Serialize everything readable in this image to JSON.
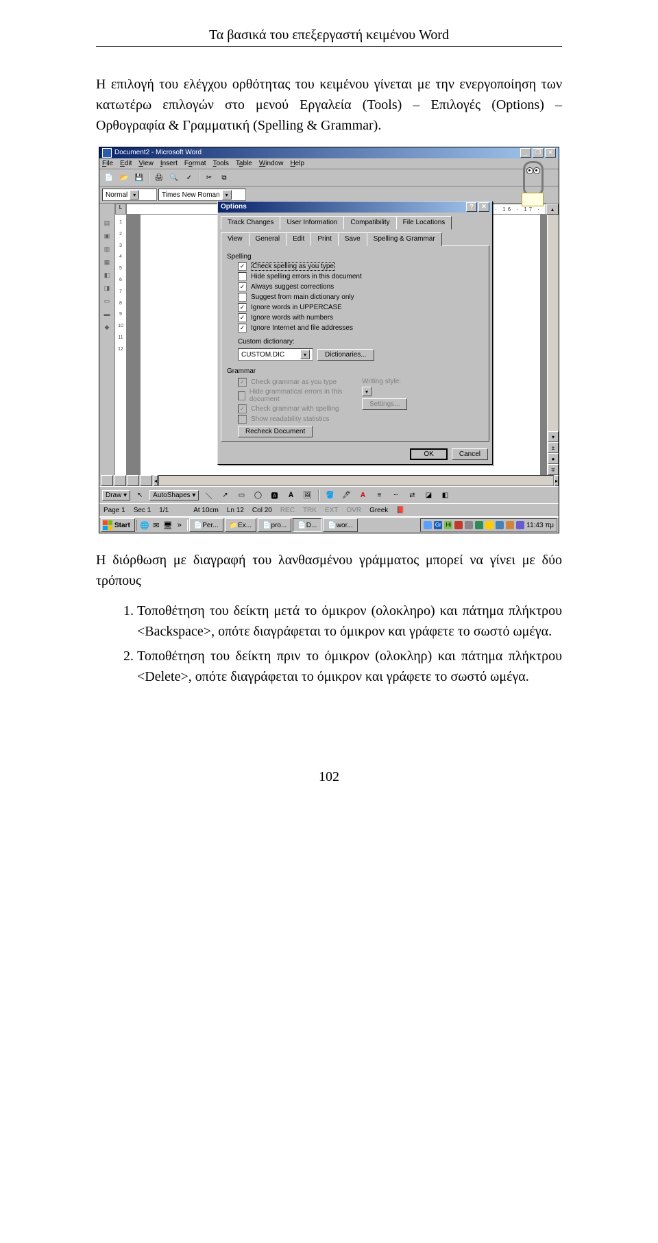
{
  "header": "Τα βασικά του επεξεργαστή κειμένου Word",
  "intro": "Η επιλογή του ελέγχου ορθότητας του κειμένου γίνεται με την ενεργοποίηση των κατωτέρω επιλογών στο μενού Εργαλεία (Tools) – Επιλογές (Options) – Ορθογραφία & Γραμματική (Spelling & Grammar).",
  "after": "Η διόρθωση με διαγραφή του λανθασμένου γράμματος μπορεί να γίνει με δύο τρόπους",
  "li1": "Τοποθέτηση του δείκτη μετά το όμικρον (ολοκληρο) και πάτημα πλήκτρου <Backspace>, οπότε διαγράφεται το όμικρον και γράφετε το σωστό ωμέγα.",
  "li2": "Τοποθέτηση του δείκτη πριν το όμικρον (ολοκληρ) και πάτημα πλήκτρου <Delete>, οπότε διαγράφεται το όμικρον και γράφετε το σωστό ωμέγα.",
  "page_number": "102",
  "word": {
    "title": "Document2 - Microsoft Word",
    "menus": {
      "file": "File",
      "edit": "Edit",
      "view": "View",
      "insert": "Insert",
      "format": "Format",
      "tools": "Tools",
      "table": "Table",
      "window": "Window",
      "help": "Help"
    },
    "style": "Normal",
    "font": "Times New Roman",
    "ruler_right": "15 · 16 · 17 ·",
    "draw": {
      "draw": "Draw",
      "autoshapes": "AutoShapes"
    },
    "status": {
      "page": "Page 1",
      "sec": "Sec 1",
      "pages": "1/1",
      "at": "At 10cm",
      "ln": "Ln 12",
      "col": "Col 20",
      "rec": "REC",
      "trk": "TRK",
      "ext": "EXT",
      "ovr": "OVR",
      "lang": "Greek"
    }
  },
  "dialog": {
    "title": "Options",
    "tabs1": {
      "track": "Track Changes",
      "user": "User Information",
      "compat": "Compatibility",
      "loc": "File Locations"
    },
    "tabs2": {
      "view": "View",
      "general": "General",
      "edit": "Edit",
      "print": "Print",
      "save": "Save",
      "spell": "Spelling & Grammar"
    },
    "spelling": {
      "label": "Spelling",
      "c1": "Check spelling as you type",
      "c2": "Hide spelling errors in this document",
      "c3": "Always suggest corrections",
      "c4": "Suggest from main dictionary only",
      "c5": "Ignore words in UPPERCASE",
      "c6": "Ignore words with numbers",
      "c7": "Ignore Internet and file addresses",
      "dict_label": "Custom dictionary:",
      "dict_value": "CUSTOM.DIC",
      "dict_btn": "Dictionaries..."
    },
    "grammar": {
      "label": "Grammar",
      "g1": "Check grammar as you type",
      "g2": "Hide grammatical errors in this document",
      "g3": "Check grammar with spelling",
      "g4": "Show readability statistics",
      "style_label": "Writing style:",
      "settings": "Settings...",
      "recheck": "Recheck Document"
    },
    "ok": "OK",
    "cancel": "Cancel"
  },
  "taskbar": {
    "start": "Start",
    "btns": {
      "per": "Per...",
      "ex": "Ex...",
      "pro": "pro...",
      "d": "D...",
      "wor": "wor..."
    },
    "gr": "Gr",
    "hi": "Hi",
    "clock": "11:43 πμ"
  }
}
